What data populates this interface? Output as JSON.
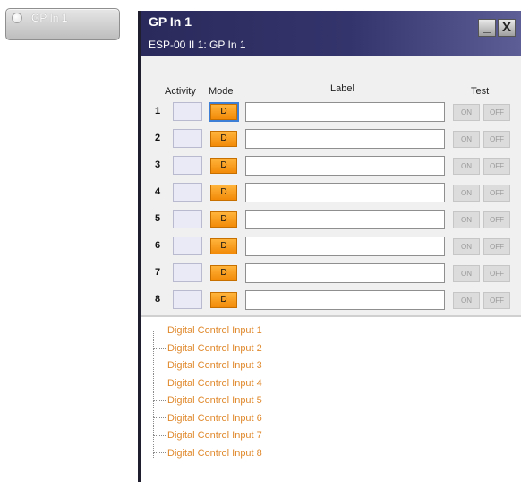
{
  "node": {
    "label": "GP In 1"
  },
  "window": {
    "title": "GP In 1",
    "subtitle": "ESP-00 II 1: GP In 1",
    "minimize_glyph": "_",
    "close_glyph": "X"
  },
  "headers": {
    "activity": "Activity",
    "mode": "Mode",
    "label": "Label",
    "test": "Test"
  },
  "rows": [
    {
      "num": "1",
      "mode": "D",
      "label": "",
      "on": "ON",
      "off": "OFF"
    },
    {
      "num": "2",
      "mode": "D",
      "label": "",
      "on": "ON",
      "off": "OFF"
    },
    {
      "num": "3",
      "mode": "D",
      "label": "",
      "on": "ON",
      "off": "OFF"
    },
    {
      "num": "4",
      "mode": "D",
      "label": "",
      "on": "ON",
      "off": "OFF"
    },
    {
      "num": "5",
      "mode": "D",
      "label": "",
      "on": "ON",
      "off": "OFF"
    },
    {
      "num": "6",
      "mode": "D",
      "label": "",
      "on": "ON",
      "off": "OFF"
    },
    {
      "num": "7",
      "mode": "D",
      "label": "",
      "on": "ON",
      "off": "OFF"
    },
    {
      "num": "8",
      "mode": "D",
      "label": "",
      "on": "ON",
      "off": "OFF"
    }
  ],
  "tree": [
    "Digital Control Input 1",
    "Digital Control Input 2",
    "Digital Control Input 3",
    "Digital Control Input 4",
    "Digital Control Input 5",
    "Digital Control Input 6",
    "Digital Control Input 7",
    "Digital Control Input 8"
  ],
  "colors": {
    "title_bar": "#2a2a5c",
    "mode_orange": "#f28a08",
    "tree_text": "#e08a2e"
  },
  "icons": {
    "node_status": "circle-indicator-icon",
    "minimize": "minimize-icon",
    "close": "close-icon"
  }
}
